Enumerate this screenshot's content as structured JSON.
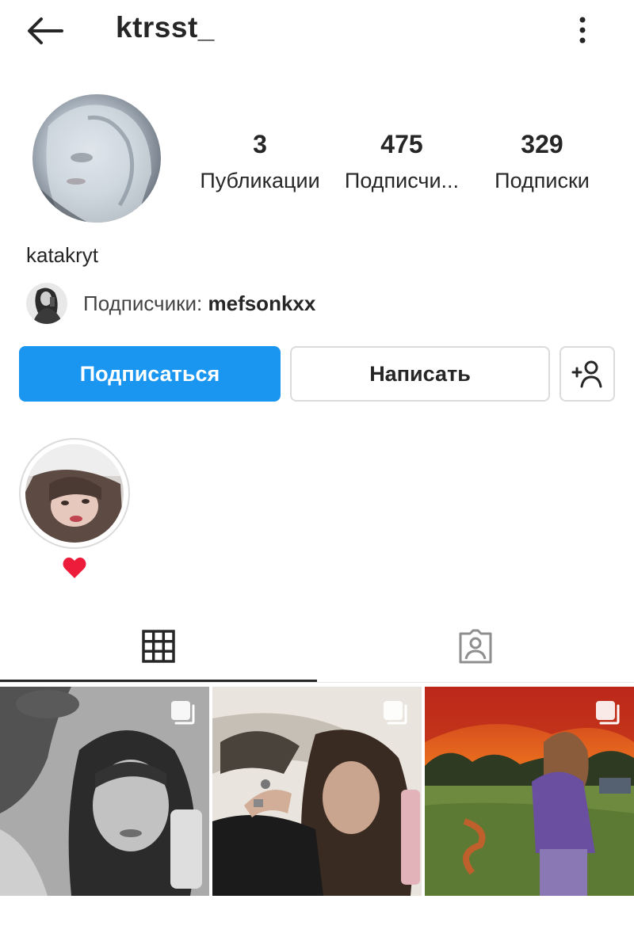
{
  "header": {
    "username": "ktrsst_",
    "back_icon": "arrow-left-icon",
    "more_icon": "more-vertical-icon"
  },
  "profile": {
    "full_name": "katakryt",
    "stats": [
      {
        "value": "3",
        "label": "Публикации"
      },
      {
        "value": "475",
        "label": "Подписчи..."
      },
      {
        "value": "329",
        "label": "Подписки"
      }
    ],
    "followed_by_prefix": "Подписчики: ",
    "followed_by_user": "mefsonkxx"
  },
  "actions": {
    "follow_label": "Подписаться",
    "message_label": "Написать",
    "add_user_icon": "add-user-icon"
  },
  "highlights": [
    {
      "title_icon": "heart-icon"
    }
  ],
  "tabs": [
    {
      "icon": "grid-icon",
      "active": true
    },
    {
      "icon": "tagged-person-icon",
      "active": false
    }
  ],
  "colors": {
    "accent": "#1a96f0",
    "text": "#262626",
    "border": "#dbdbdb",
    "heart": "#ed1c3a"
  },
  "posts": [
    {
      "type": "photo",
      "multi": true
    },
    {
      "type": "photo",
      "multi": true
    },
    {
      "type": "photo",
      "multi": true
    }
  ]
}
